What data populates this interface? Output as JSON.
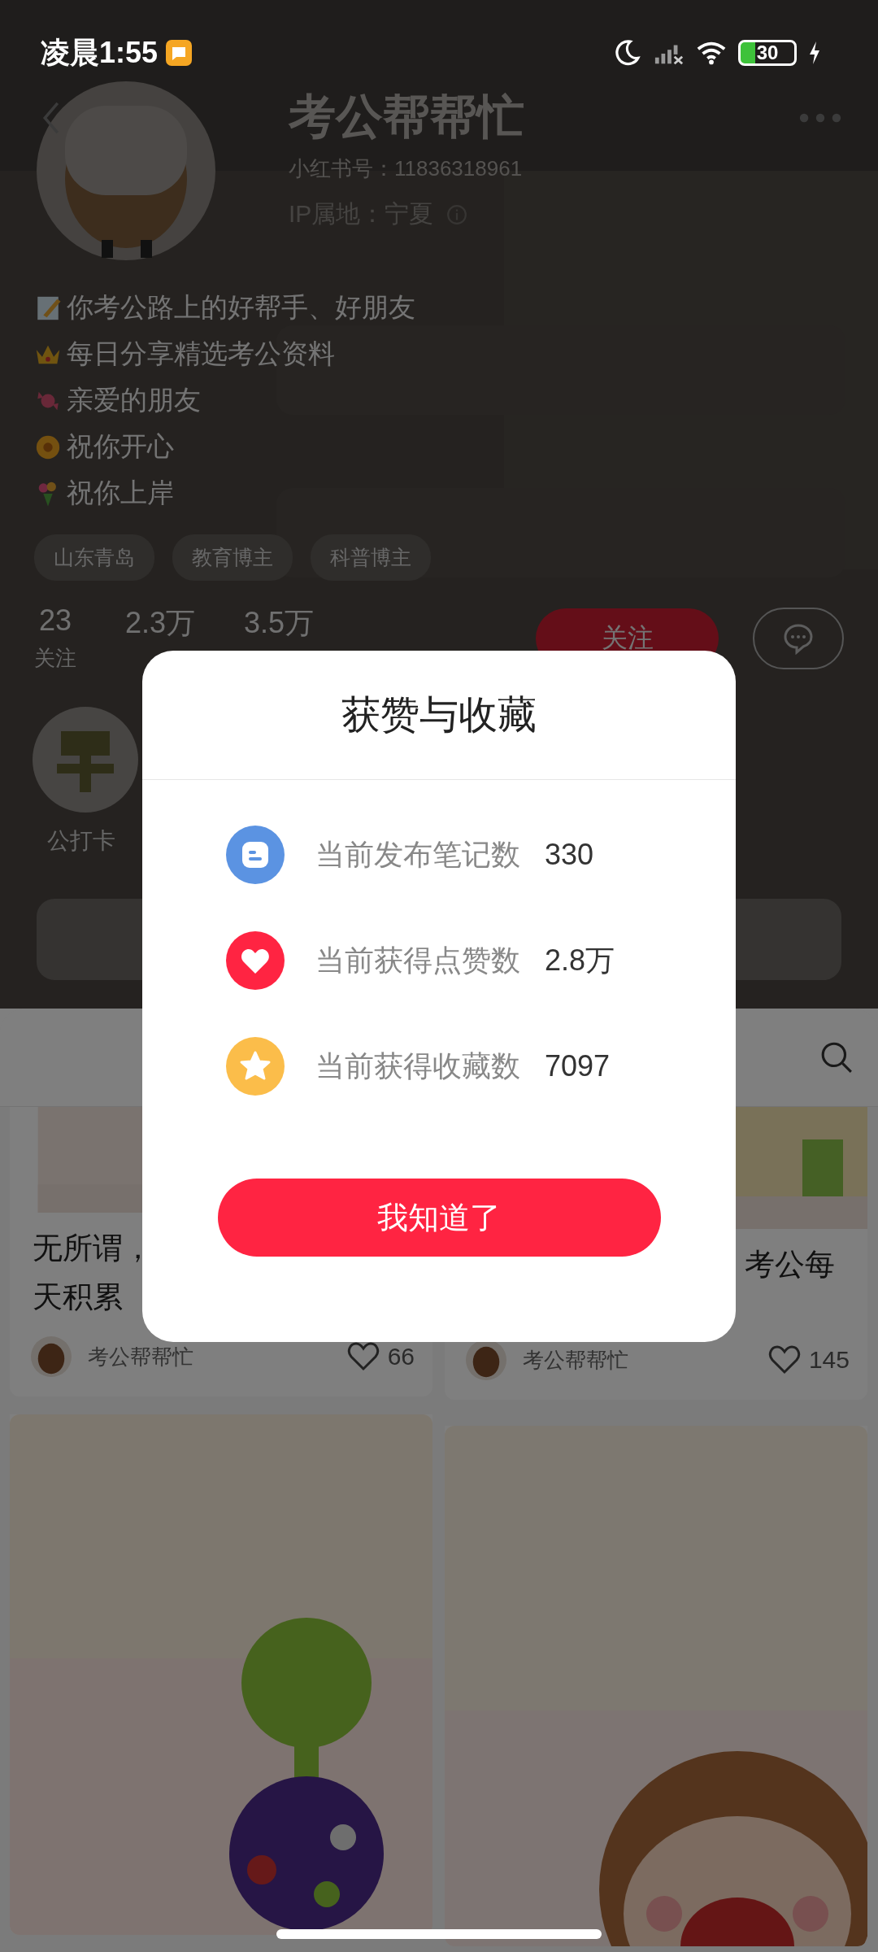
{
  "status_bar": {
    "time": "凌晨1:55",
    "battery": "30"
  },
  "profile": {
    "name": "考公帮帮忙",
    "id_line": "小红书号：11836318961",
    "ip_line": "IP属地：宁夏",
    "bio": [
      "你考公路上的好帮手、好朋友",
      "每日分享精选考公资料",
      "亲爱的朋友",
      "祝你开心",
      "祝你上岸"
    ],
    "tags": [
      "山东青岛",
      "教育博主",
      "科普博主"
    ],
    "stats": [
      {
        "value": "23",
        "label": "关注"
      },
      {
        "value": "2.3万"
      },
      {
        "value": "3.5万"
      }
    ],
    "follow_button": "关注"
  },
  "highlights": [
    {
      "label": "公打卡"
    }
  ],
  "notes": [
    {
      "kind": "note",
      "caption": [
        "无所谓，",
        "天积累"
      ],
      "author": "考公帮帮忙",
      "likes": "66"
    },
    {
      "kind": "note",
      "caption": [
        "考公每"
      ],
      "author": "考公帮帮忙",
      "likes": "145"
    },
    {
      "kind": "picture"
    },
    {
      "kind": "picture"
    }
  ],
  "dialog": {
    "title": "获赞与收藏",
    "rows": [
      {
        "kind": "notes",
        "label": "当前发布笔记数",
        "value": "330"
      },
      {
        "kind": "likes",
        "label": "当前获得点赞数",
        "value": "2.8万"
      },
      {
        "kind": "collects",
        "label": "当前获得收藏数",
        "value": "7097"
      }
    ],
    "button": "我知道了"
  }
}
